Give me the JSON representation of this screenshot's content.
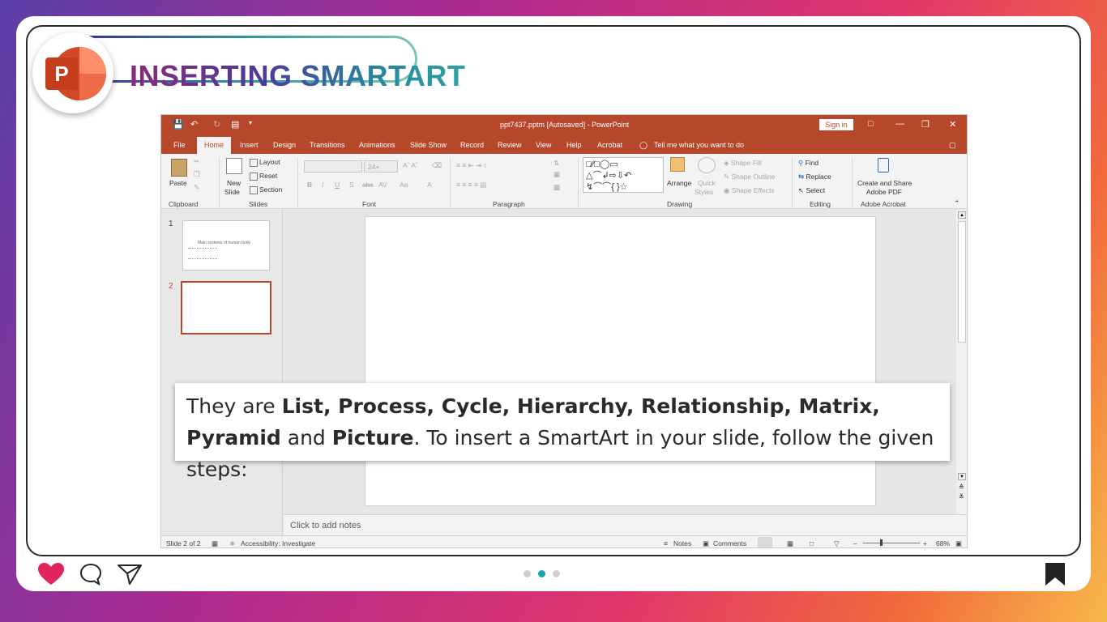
{
  "header": {
    "title": "INSERTING SMARTART",
    "logo_letter": "P"
  },
  "window": {
    "title": "ppt7437.pptm [Autosaved] - PowerPoint",
    "sign_in": "Sign in",
    "tabs": [
      "File",
      "Home",
      "Insert",
      "Design",
      "Transitions",
      "Animations",
      "Slide Show",
      "Record",
      "Review",
      "View",
      "Help",
      "Acrobat"
    ],
    "active_tab": "Home",
    "tell_me": "Tell me what you want to do"
  },
  "ribbon": {
    "clipboard": {
      "label": "Clipboard",
      "paste": "Paste"
    },
    "slides": {
      "label": "Slides",
      "new_slide": "New",
      "new_slide2": "Slide",
      "layout": "Layout",
      "reset": "Reset",
      "section": "Section"
    },
    "font": {
      "label": "Font",
      "size": "24+"
    },
    "paragraph": {
      "label": "Paragraph"
    },
    "drawing": {
      "label": "Drawing",
      "arrange": "Arrange",
      "quick_styles": "Quick",
      "quick_styles2": "Styles",
      "shape_fill": "Shape Fill",
      "shape_outline": "Shape Outline",
      "shape_effects": "Shape Effects"
    },
    "editing": {
      "label": "Editing",
      "find": "Find",
      "replace": "Replace",
      "select": "Select"
    },
    "acrobat": {
      "label": "Adobe Acrobat",
      "create": "Create and Share",
      "create2": "Adobe PDF"
    }
  },
  "thumbnails": [
    {
      "number": "1",
      "title": "Main systems of human body"
    },
    {
      "number": "2",
      "title": ""
    }
  ],
  "notes_placeholder": "Click to add notes",
  "status": {
    "slide": "Slide 2 of 2",
    "accessibility": "Accessibility: Investigate",
    "notes": "Notes",
    "comments": "Comments",
    "zoom": "68%"
  },
  "caption": {
    "intro": "They are ",
    "types": "List, Process, Cycle, Hierarchy, Relationship, Matrix, Pyramid",
    "and": " and ",
    "last": "Picture",
    "rest": ". To insert a SmartArt in your slide, follow the given steps:"
  },
  "colors": {
    "ppt_accent": "#b7472a",
    "active_dot": "#1fa3b8",
    "heart": "#e0245e"
  },
  "pagination": {
    "total": 3,
    "active": 2
  }
}
